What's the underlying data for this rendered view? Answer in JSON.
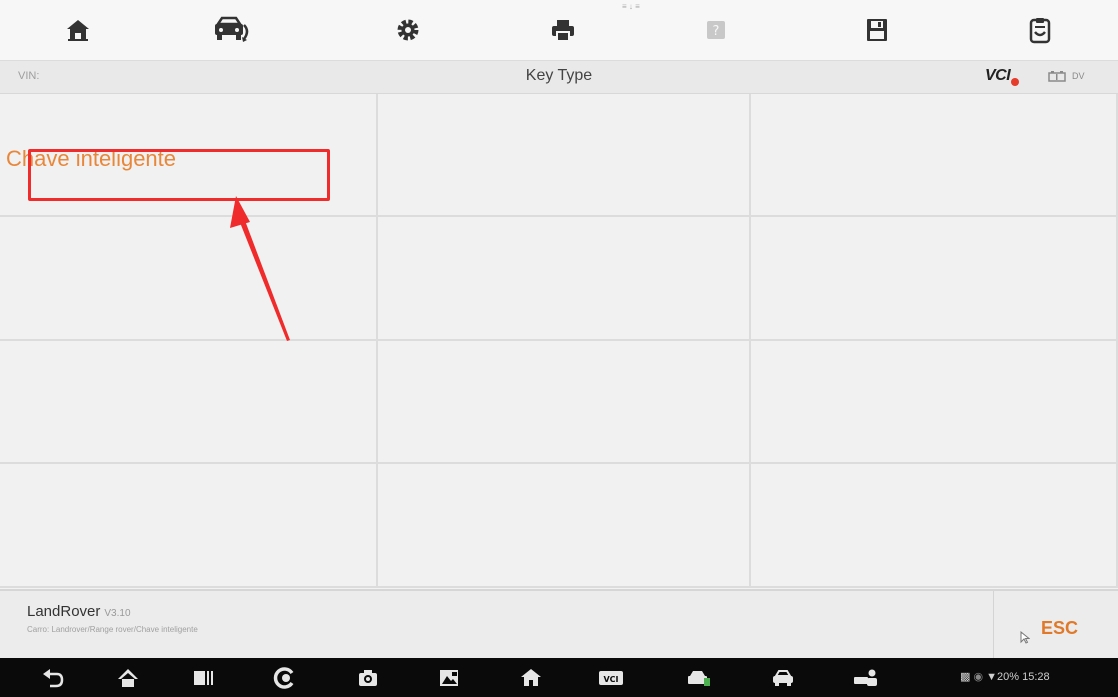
{
  "toolbar": {
    "hint": "≡ ↓ ≡",
    "buttons": [
      {
        "name": "home-icon"
      },
      {
        "name": "vehicle-swap-icon"
      },
      {
        "name": "settings-gear-icon"
      },
      {
        "name": "print-icon"
      },
      {
        "name": "help-icon"
      },
      {
        "name": "save-icon"
      },
      {
        "name": "data-log-icon"
      }
    ]
  },
  "titlebar": {
    "vin_label": "VIN:",
    "title": "Key Type",
    "vci_label": "VCI",
    "battery_text": "DV"
  },
  "grid": {
    "cells": [
      "Chave inteligente",
      "",
      "",
      "",
      "",
      "",
      "",
      "",
      "",
      "",
      "",
      ""
    ]
  },
  "footer": {
    "title": "LandRover",
    "version": "V3.10",
    "path": "Carro: Landrover/Range rover/Chave inteligente",
    "esc_label": "ESC"
  },
  "navbar": {
    "status_text": "20% 15:28"
  },
  "colors": {
    "accent_orange": "#e8873a",
    "highlight_red": "#ef2b2b"
  }
}
